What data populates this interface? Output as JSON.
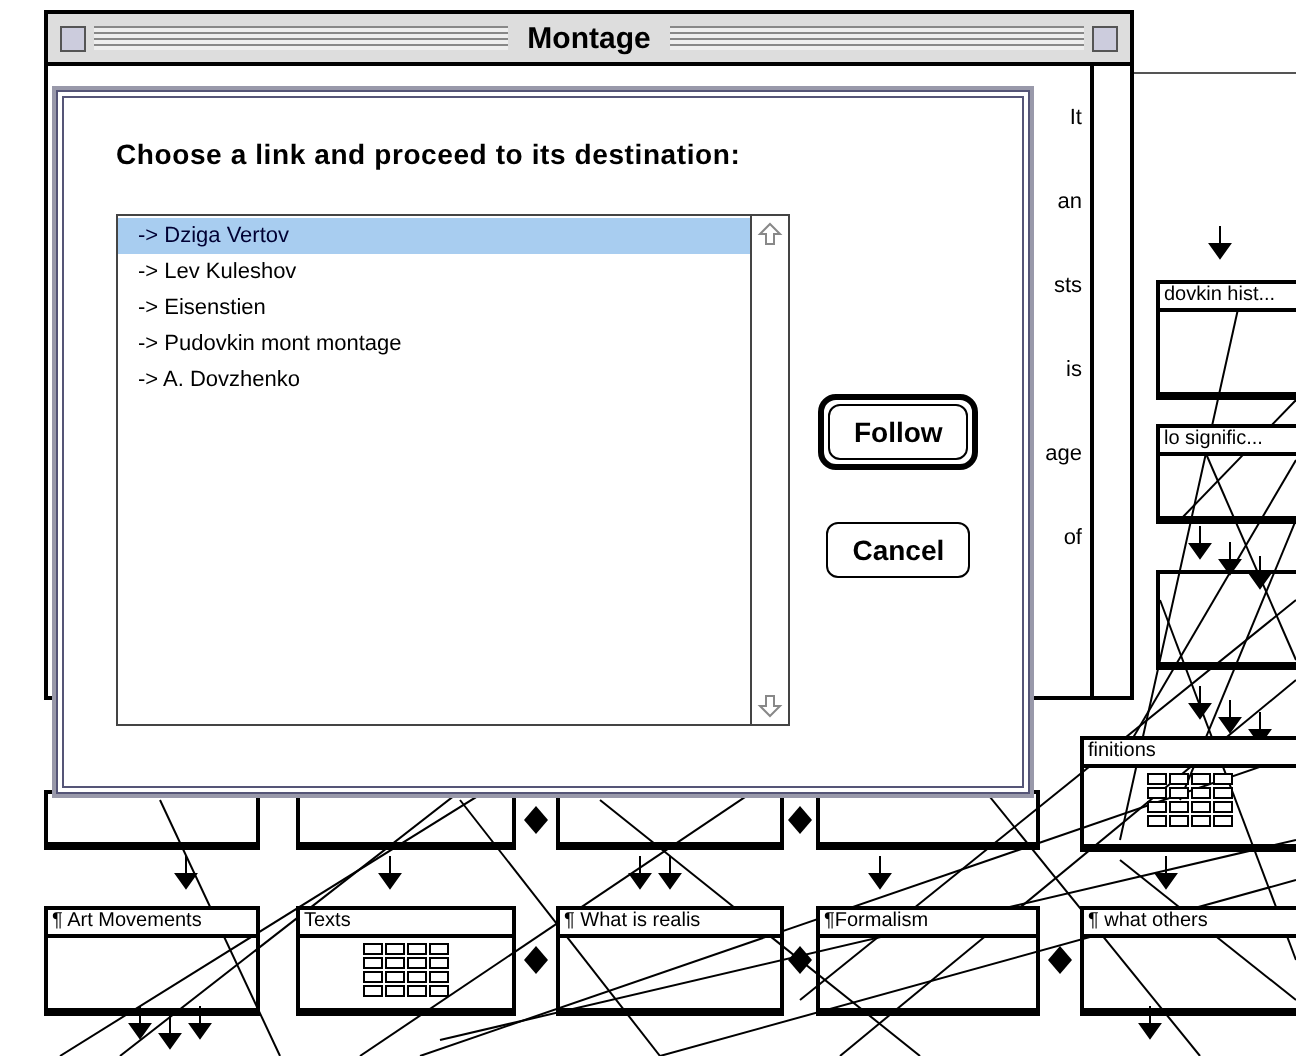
{
  "window": {
    "title": "Montage"
  },
  "background_text": [
    "It",
    "an",
    "sts",
    "is",
    "age",
    "of"
  ],
  "dialog": {
    "prompt": "Choose a link and proceed to its destination:",
    "links": [
      {
        "label": "-> Dziga Vertov",
        "selected": true
      },
      {
        "label": "-> Lev Kuleshov",
        "selected": false
      },
      {
        "label": "-> Eisenstien",
        "selected": false
      },
      {
        "label": "-> Pudovkin mont montage",
        "selected": false
      },
      {
        "label": "-> A. Dovzhenko",
        "selected": false
      }
    ],
    "buttons": [
      {
        "label": "Follow",
        "default": true
      },
      {
        "label": "Cancel",
        "default": false
      }
    ]
  },
  "nodes": [
    {
      "label": "dovkin hist...",
      "kind": "plain"
    },
    {
      "label": "lo signific...",
      "kind": "plain"
    },
    {
      "label": "finitions",
      "kind": "grid"
    },
    {
      "label": "¶ Art Movements",
      "kind": "plain"
    },
    {
      "label": "Texts",
      "kind": "grid"
    },
    {
      "label": "¶ What is realis",
      "kind": "plain"
    },
    {
      "label": "¶Formalism",
      "kind": "plain"
    },
    {
      "label": "¶ what others",
      "kind": "plain"
    }
  ]
}
